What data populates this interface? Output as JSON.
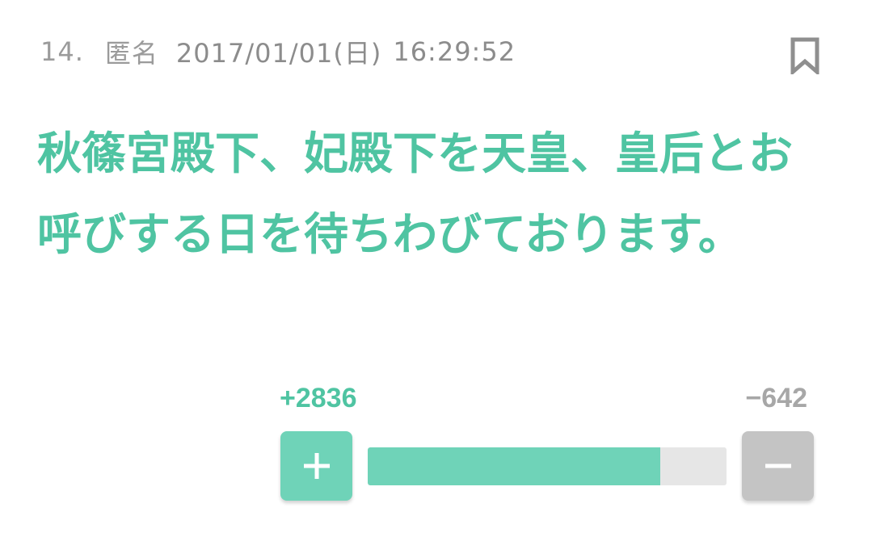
{
  "post": {
    "number": "14.",
    "author": "匿名",
    "date": "2017/01/01(日)",
    "time": "16:29:52",
    "body": "秋篠宮殿下、妃殿下を天皇、皇后とお呼びする日を待ちわびております。"
  },
  "votes": {
    "plus_label": "+2836",
    "minus_label": "−642",
    "plus_count": 2836,
    "minus_count": 642,
    "positive_ratio": 0.8154,
    "plus_button_icon": "plus-icon",
    "minus_button_icon": "minus-icon"
  },
  "colors": {
    "accent": "#4fc4a2",
    "accent_light": "#6fd3b8",
    "neutral_button": "#c4c4c4",
    "track": "#e6e6e6",
    "meta_text": "#9b9b9b"
  },
  "icons": {
    "bookmark": "bookmark-icon"
  }
}
